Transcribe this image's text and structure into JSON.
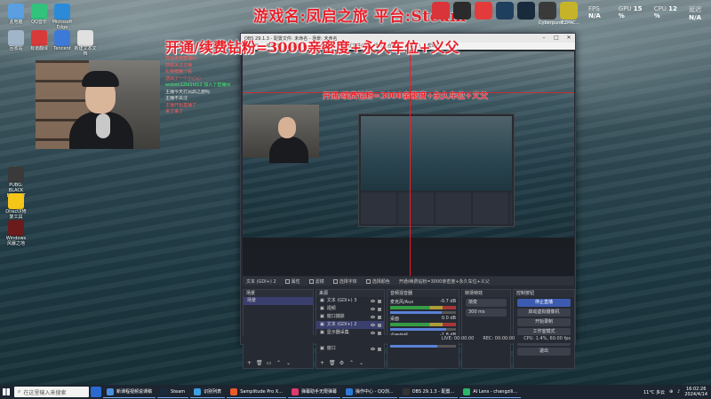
{
  "overlay": {
    "game_title": "游戏名:凤启之旅 平台:Steam",
    "banner": "开通/续费钻粉=3000亲密度+永久车位+义父",
    "perf": [
      {
        "label": "FPS",
        "value": "N/A"
      },
      {
        "label": "GPU",
        "value": "15 %"
      },
      {
        "label": "CPU",
        "value": "12 %"
      },
      {
        "label": "延迟",
        "value": "N/A"
      }
    ],
    "top_icons": [
      {
        "name": "netease-icon",
        "color": "#d9343a",
        "label": ""
      },
      {
        "name": "app-icon-1",
        "color": "#2b2b2b",
        "label": ""
      },
      {
        "name": "app-icon-2",
        "color": "#e33b3b",
        "label": ""
      },
      {
        "name": "app-icon-3",
        "color": "#1f3f5e",
        "label": ""
      },
      {
        "name": "steam-icon",
        "color": "#1a2a3d",
        "label": ""
      },
      {
        "name": "app-icon-4",
        "color": "#3a3a3a",
        "label": "Cyberpunk"
      },
      {
        "name": "app-icon-5",
        "color": "#c6b32a",
        "label": "EZPAC..."
      }
    ]
  },
  "desktop_icons": [
    {
      "label": "此电脑",
      "color": "#5aa0e0"
    },
    {
      "label": "QQ音乐",
      "color": "#31c27c"
    },
    {
      "label": "Microsoft Edge",
      "color": "#2b8bd8"
    },
    {
      "label": "回收站",
      "color": "#9fb6c8"
    },
    {
      "label": "有道翻译",
      "color": "#d83a3a"
    },
    {
      "label": "Tencent",
      "color": "#3d7ad8"
    },
    {
      "label": "新建文本文档",
      "color": "#e0e0e0"
    },
    {
      "label": "PUBG: BLACK BUDGET",
      "color": "#3a3a3a"
    },
    {
      "label": "DirectX修复工具",
      "color": "#f5c518"
    },
    {
      "label": "Windows 风暴之地",
      "color": "#6a1b1b"
    }
  ],
  "chat": [
    {
      "text": "开通/续费钻粉3000亲密度",
      "style": "red"
    },
    {
      "text": "谢谢哥送出",
      "style": "red"
    },
    {
      "text": "欢迎来到直播间",
      "style": "red"
    },
    {
      "text": "感谢关注主播",
      "style": "red"
    },
    {
      "text": "礼物榜第一名",
      "style": "red"
    },
    {
      "text": "送出了一个小心心",
      "style": "red"
    },
    {
      "text": "woben12ld1ld12 加入了直播间",
      "style": "green"
    },
    {
      "text": "主播今天打凤启之旅吗",
      "style": "white"
    },
    {
      "text": "主播不关注",
      "style": "white"
    },
    {
      "text": "主播开始直播了",
      "style": "red"
    },
    {
      "text": "来了来了",
      "style": "red"
    }
  ],
  "obs": {
    "title": "OBS 29.1.3 - 配置文件: 未命名 - 场景: 未命名",
    "menu": [
      "文件(F)",
      "编辑(E)",
      "视图(V)",
      "停靠部件(D)",
      "配置文件(P)",
      "场景集合(S)",
      "工具(T)",
      "帮助(H)"
    ],
    "preview_banner": "开通/续费钻粉=3000亲密度+永久车位+义父",
    "toolbar": [
      "文本 (GDI+) 2",
      "属性",
      "滤镜",
      "选择字体",
      "选择颜色",
      "开通/续费钻粉=3000亲密度+永久车位+义父"
    ],
    "scenes_title": "场景",
    "scenes": [
      "场景"
    ],
    "sources_title": "来源",
    "sources": [
      "文本 (GDI+) 3",
      "视频",
      "窗口捕获",
      "文本 (GDI+) 2",
      "显示器采集",
      "摄像头",
      "窗口"
    ],
    "mixer_title": "音频混音器",
    "mixer": [
      {
        "name": "麦克风/Aux",
        "db": "-0.7 dB",
        "level": 0.78
      },
      {
        "name": "桌面",
        "db": "0.0 dB",
        "level": 0.85
      },
      {
        "name": "桌面音频",
        "db": "-1.8 dB",
        "level": 0.72
      }
    ],
    "transitions_title": "转场特效",
    "transition_type": "渐变",
    "transition_duration": "300 ms",
    "controls_title": "控制按钮",
    "controls": [
      "停止直播",
      "启动虚拟摄像机",
      "开始录制",
      "工作室模式",
      "设置",
      "退出"
    ],
    "status": [
      "LIVE: 00:00:00",
      "REC: 00:00:00",
      "CPU: 1.4%, 60.00 fps"
    ]
  },
  "taskbar": {
    "search_placeholder": "在这里输入来搜索",
    "apps": [
      {
        "label": "新课程视频说课稿",
        "color": "#4a8fe0"
      },
      {
        "label": "Steam",
        "color": "#1a2a3d"
      },
      {
        "label": "识别列表",
        "color": "#3ca0e0"
      },
      {
        "label": "Samplitude Pro X...",
        "color": "#e85a2a"
      },
      {
        "label": "弹幕助手无限弹幕",
        "color": "#e03a6a"
      },
      {
        "label": "操作中心 - QQ浏...",
        "color": "#2a7ad8"
      },
      {
        "label": "OBS 29.1.3 - 配置...",
        "color": "#333"
      },
      {
        "label": "AI Lens - changzili...",
        "color": "#2ab56a"
      }
    ],
    "weather": "11°C 多云",
    "time": "16:02:26",
    "date": "2024/4/14"
  }
}
